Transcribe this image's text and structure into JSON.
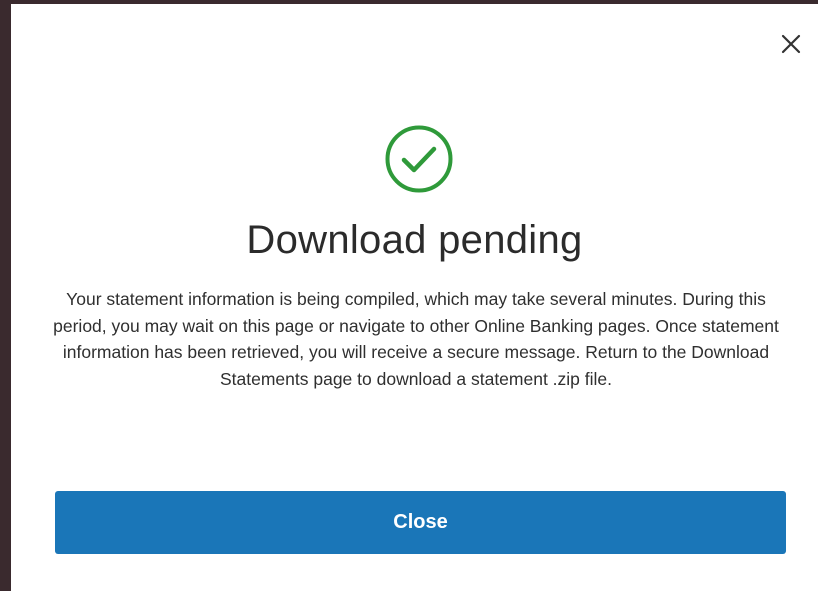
{
  "dialog": {
    "title": "Download pending",
    "message": "Your statement information is being compiled, which may take several minutes. During this period, you may wait on this page or navigate to other Online Banking pages. Once statement information has been retrieved, you will receive a secure message. Return to the Download Statements page to download a statement .zip file.",
    "close_button_label": "Close",
    "icons": {
      "close": "close-icon",
      "status": "check-circle-icon"
    },
    "colors": {
      "success": "#2f9a3a",
      "primary_button": "#1a76b8"
    }
  }
}
